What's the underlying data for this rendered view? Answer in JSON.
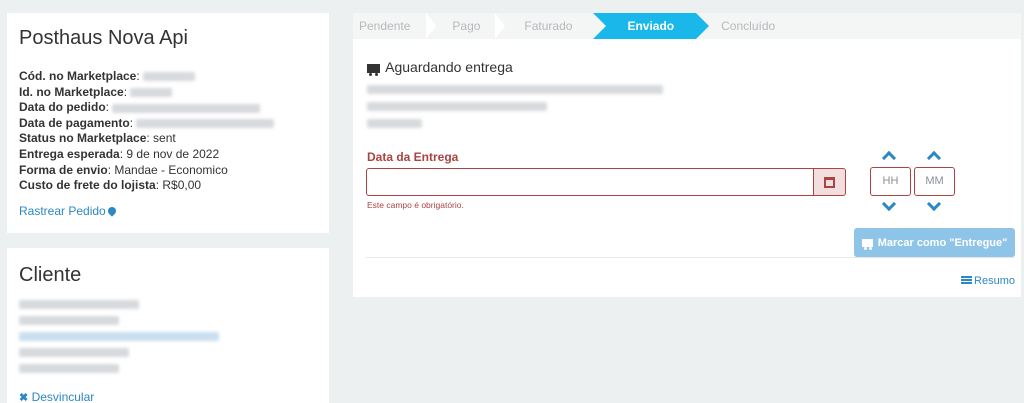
{
  "order": {
    "title": "Posthaus Nova Api",
    "fields": [
      {
        "label": "Cód. no Marketplace",
        "value": ""
      },
      {
        "label": "Id. no Marketplace",
        "value": ""
      },
      {
        "label": "Data do pedido",
        "value": ""
      },
      {
        "label": "Data de pagamento",
        "value": ""
      },
      {
        "label": "Status no Marketplace",
        "value": "sent"
      },
      {
        "label": "Entrega esperada",
        "value": "9 de nov de 2022"
      },
      {
        "label": "Forma de envio",
        "value": "Mandae - Economico"
      },
      {
        "label": "Custo de frete do lojista",
        "value": "R$0,00"
      }
    ],
    "track_link": "Rastrear Pedido"
  },
  "client": {
    "title": "Cliente",
    "unlink_label": "Desvincular"
  },
  "steps": [
    "Pendente",
    "Pago",
    "Faturado",
    "Enviado",
    "Concluído"
  ],
  "active_step": "Enviado",
  "shipment": {
    "status": "Aguardando entrega",
    "date_label": "Data da Entrega",
    "date_value": "",
    "error": "Este campo é obrigatório.",
    "hour_placeholder": "HH",
    "minute_placeholder": "MM",
    "mark_button": "Marcar como \"Entregue\"",
    "summary_link": "Resumo"
  },
  "colors": {
    "accent": "#1ab8ea",
    "link": "#2c88c4",
    "error": "#a94442",
    "button_disabled": "#8fc4e9"
  }
}
